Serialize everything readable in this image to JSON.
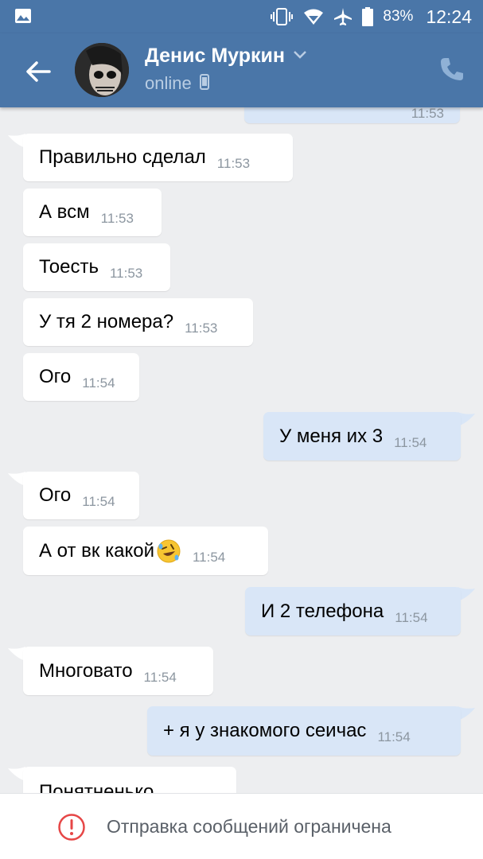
{
  "statusbar": {
    "battery": "83%",
    "time": "12:24",
    "icons": [
      "gallery-icon",
      "vibrate-icon",
      "wifi-icon",
      "airplane-icon",
      "battery-icon"
    ]
  },
  "header": {
    "name": "Денис Муркин",
    "status": "online",
    "icons": [
      "back-arrow-icon",
      "chevron-down-icon",
      "mobile-icon",
      "phone-icon"
    ]
  },
  "messages": [
    {
      "dir": "out",
      "text": "",
      "time": "11:53"
    },
    {
      "dir": "in",
      "text": "Правильно сделал",
      "time": "11:53"
    },
    {
      "dir": "in",
      "text": "А всм",
      "time": "11:53"
    },
    {
      "dir": "in",
      "text": "Тоесть",
      "time": "11:53"
    },
    {
      "dir": "in",
      "text": "У тя 2 номера?",
      "time": "11:53"
    },
    {
      "dir": "in",
      "text": "Ого",
      "time": "11:54"
    },
    {
      "dir": "out",
      "text": "У меня их 3",
      "time": "11:54"
    },
    {
      "dir": "in",
      "text": "Ого",
      "time": "11:54"
    },
    {
      "dir": "in",
      "text": "А от вк какой",
      "emoji": "rofl",
      "time": "11:54"
    },
    {
      "dir": "out",
      "text": "И 2 телефона",
      "time": "11:54"
    },
    {
      "dir": "in",
      "text": "Многовато",
      "time": "11:54"
    },
    {
      "dir": "out",
      "text": "+ я у знакомого сеичас",
      "time": "11:54"
    },
    {
      "dir": "in",
      "text": "Понятненько",
      "time": ""
    }
  ],
  "bottom": {
    "notice": "Отправка сообщений ограничена",
    "icon": "warning-icon"
  },
  "colors": {
    "header": "#4a76a8",
    "background": "#edeef0",
    "incoming": "#ffffff",
    "outgoing": "#d9e6f7",
    "warning": "#e64646"
  }
}
